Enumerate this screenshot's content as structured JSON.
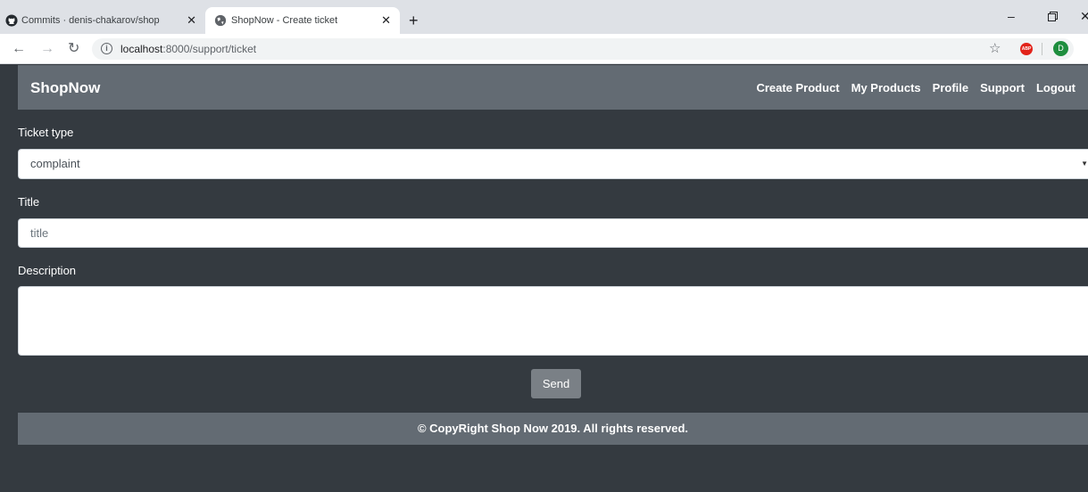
{
  "browser": {
    "tabs": [
      {
        "title": "Commits · denis-chakarov/shopn",
        "close": "✕"
      },
      {
        "title": "ShopNow - Create ticket",
        "close": "✕"
      }
    ],
    "new_tab": "+",
    "url_host": "localhost",
    "url_rest": ":8000/support/ticket",
    "profile_initial": "D",
    "adblock_label": "ABP"
  },
  "navbar": {
    "brand": "ShopNow",
    "links": [
      "Create Product",
      "My Products",
      "Profile",
      "Support",
      "Logout"
    ]
  },
  "form": {
    "ticket_type_label": "Ticket type",
    "ticket_type_value": "complaint",
    "title_label": "Title",
    "title_placeholder": "title",
    "description_label": "Description",
    "description_value": "",
    "send_label": "Send"
  },
  "footer": {
    "text": "© CopyRight Shop Now 2019. All rights reserved."
  }
}
